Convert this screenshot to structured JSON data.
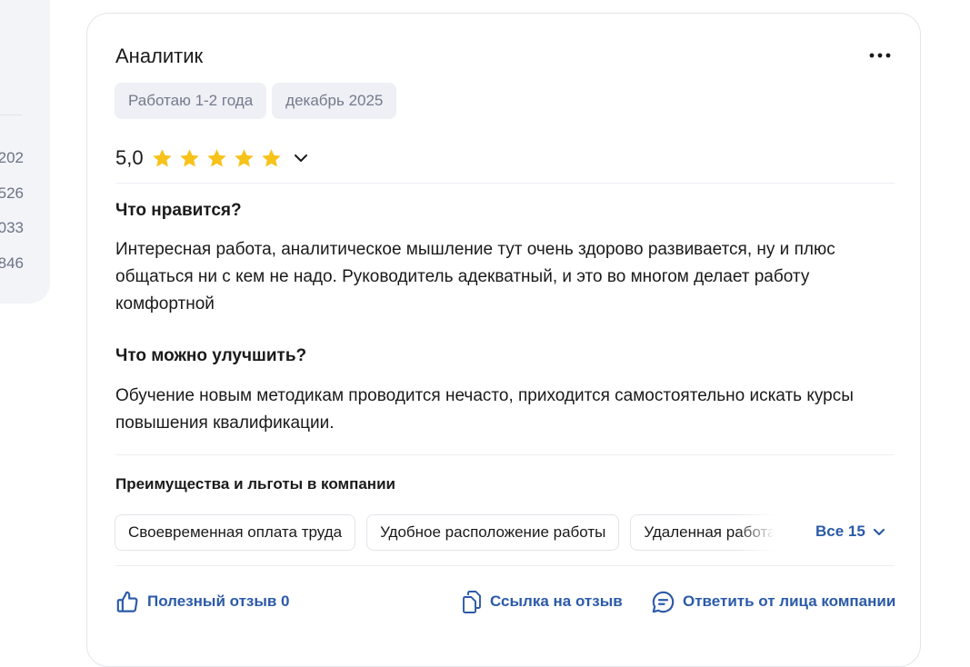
{
  "left_panel": {
    "numbers": [
      "202",
      "526",
      "033",
      "846"
    ]
  },
  "review": {
    "title": "Аналитик",
    "tags": [
      "Работаю 1-2 года",
      "декабрь 2025"
    ],
    "rating": "5,0",
    "stars": 5,
    "colors": {
      "star": "#f7c21a",
      "link": "#2b5aa8",
      "tag_bg": "#eef0f5"
    },
    "likes_title": "Что нравится?",
    "likes_text": "Интересная работа, аналитическое мышление тут очень здорово развивается, ну и плюс общаться ни с кем не надо. Руководитель адекватный, и это во многом делает работу комфортной",
    "improve_title": "Что можно улучшить?",
    "improve_text": "Обучение новым методикам проводится нечасто, приходится самостоятельно искать курсы повышения квалификации.",
    "benefits_title": "Преимущества и льготы в компании",
    "benefits": [
      "Своевременная оплата труда",
      "Удобное расположение работы",
      "Удаленная работа"
    ],
    "all_benefits_label": "Все 15",
    "actions": {
      "helpful": "Полезный отзыв 0",
      "link": "Ссылка на отзыв",
      "reply": "Ответить от лица компании"
    }
  }
}
